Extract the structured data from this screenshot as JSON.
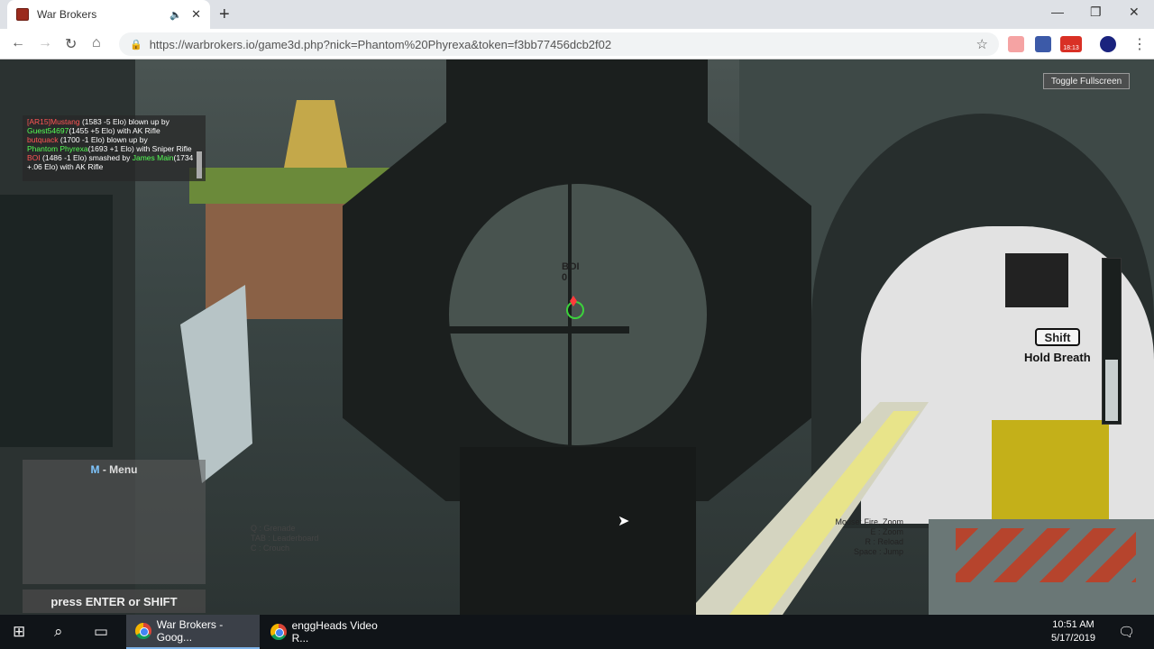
{
  "browser": {
    "tab_title": "War Brokers",
    "url": "https://warbrokers.io/game3d.php?nick=Phantom%20Phyrexa&token=f3bb77456dcb2f02",
    "extension_badge": "18:13",
    "icons": {
      "audio": "speaker-icon",
      "close": "close-icon",
      "new_tab": "plus-icon",
      "back": "back-icon",
      "forward": "forward-icon",
      "reload": "reload-icon",
      "home": "home-icon",
      "lock": "lock-icon",
      "star": "star-icon"
    }
  },
  "game": {
    "killfeed": [
      {
        "a": "[AR15]Mustang",
        "a_color": "red",
        "b": " (1583 -5 Elo) blown up by"
      },
      {
        "a": "Guest54697",
        "a_color": "green",
        "b": "(1455 +5 Elo)  with AK Rifle"
      },
      {
        "a": "butquack",
        "a_color": "red",
        "b": " (1700 -1 Elo) blown up by"
      },
      {
        "a": "Phantom Phyrexa",
        "a_color": "green",
        "b": "(1693 +1 Elo)  with Sniper Rifle"
      },
      {
        "a": "BOI",
        "a_color": "red",
        "b": " (1486 -1 Elo) smashed by ",
        "c": "James Main",
        "c_color": "green",
        "d": "(1734 +.06 Elo)  with AK Rifle"
      }
    ],
    "toggle_fullscreen": "Toggle Fullscreen",
    "menu_key": "M",
    "menu_label": " - Menu",
    "enter_prompt": "press ENTER or SHIFT",
    "shift_badge": "Shift",
    "hold_breath": "Hold Breath",
    "enemy_name": "BOI",
    "enemy_sub": "0",
    "breath_level": 0.38,
    "controls_right": [
      "Mouse: Fire, Zoom",
      "E : Zoom",
      "R : Reload",
      "Space : Jump"
    ],
    "controls_left": [
      "Q : Grenade",
      "TAB : Leaderboard",
      "C : Crouch"
    ]
  },
  "taskbar": {
    "apps": [
      {
        "label": "War Brokers - Goog...",
        "active": true
      },
      {
        "label": "enggHeads Video R...",
        "active": false
      }
    ],
    "time": "10:51 AM",
    "date": "5/17/2019",
    "notification_count": "1"
  }
}
